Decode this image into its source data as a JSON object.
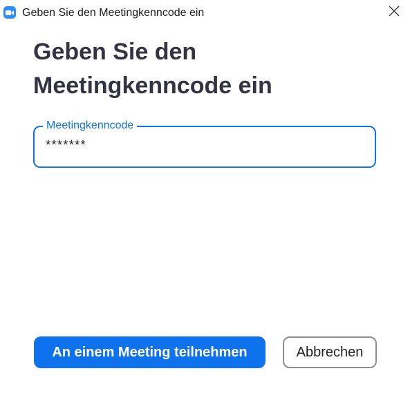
{
  "window": {
    "title": "Geben Sie den Meetingkenncode ein",
    "app_icon": "zoom-video-camera-icon",
    "close_icon": "close-icon"
  },
  "main": {
    "heading": "Geben Sie den Meetingkenncode ein",
    "passcode_field": {
      "label": "Meetingkenncode",
      "value": "*******"
    }
  },
  "actions": {
    "join_label": "An einem Meeting teilnehmen",
    "cancel_label": "Abbrechen"
  },
  "colors": {
    "accent": "#0e72ed",
    "heading_text": "#333344",
    "app_icon_bg": "#2d8cff",
    "secondary_border": "#8c8c8c"
  }
}
